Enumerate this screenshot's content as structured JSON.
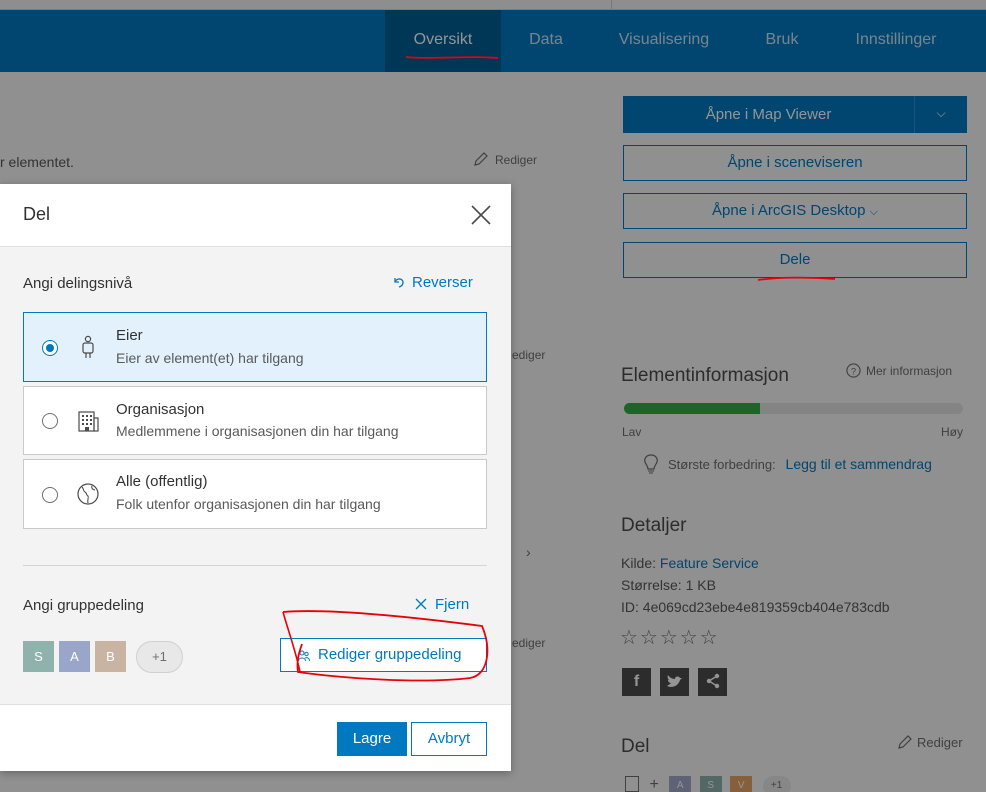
{
  "nav": {
    "tabs": [
      "Oversikt",
      "Data",
      "Visualisering",
      "Bruk",
      "Innstillinger"
    ],
    "active": "Oversikt"
  },
  "background": {
    "desc_snippet": "r elementet.",
    "edit_label": "Rediger",
    "edit_label_2": "edigerr",
    "edit_label_3": "ediger",
    "buttons": {
      "open_map_viewer": "Åpne i Map Viewer",
      "open_scene": "Åpne i sceneviseren",
      "open_desktop": "Åpne i ArcGIS Desktop",
      "share": "Dele"
    },
    "item_info": {
      "title": "Elementinformasjon",
      "more": "Mer informasjon",
      "low": "Lav",
      "high": "Høy",
      "meter_fraction": 0.4,
      "improve_label": "Største forbedring:",
      "improve_link": "Legg til et sammendrag"
    },
    "details": {
      "title": "Detaljer",
      "source_label": "Kilde:",
      "source_value": "Feature Service",
      "size": "Størrelse: 1 KB",
      "id": "ID: 4e069cd23ebe4e819359cb404e783cdb",
      "stars": "☆☆☆☆☆"
    },
    "share_section": {
      "title": "Del",
      "edit": "Rediger",
      "chips": [
        "A",
        "S",
        "V",
        "+1"
      ]
    }
  },
  "dialog": {
    "title": "Del",
    "level_label": "Angi delingsnivå",
    "revert": "Reverser",
    "options": [
      {
        "title": "Eier",
        "desc": "Eier av element(et) har tilgang",
        "selected": true
      },
      {
        "title": "Organisasjon",
        "desc": "Medlemmene i organisasjonen din har tilgang",
        "selected": false
      },
      {
        "title": "Alle (offentlig)",
        "desc": "Folk utenfor organisasjonen din har tilgang",
        "selected": false
      }
    ],
    "group_label": "Angi gruppedeling",
    "remove": "Fjern",
    "groups": [
      "S",
      "A",
      "B"
    ],
    "groups_more": "+1",
    "edit_groups": "Rediger gruppedeling",
    "save": "Lagre",
    "cancel": "Avbryt"
  },
  "colors": {
    "accent": "#0079c1",
    "chip_s": "#8fb3ac",
    "chip_a": "#9aa6c9",
    "chip_b": "#c9b4a3",
    "annotation": "#e8000b"
  }
}
